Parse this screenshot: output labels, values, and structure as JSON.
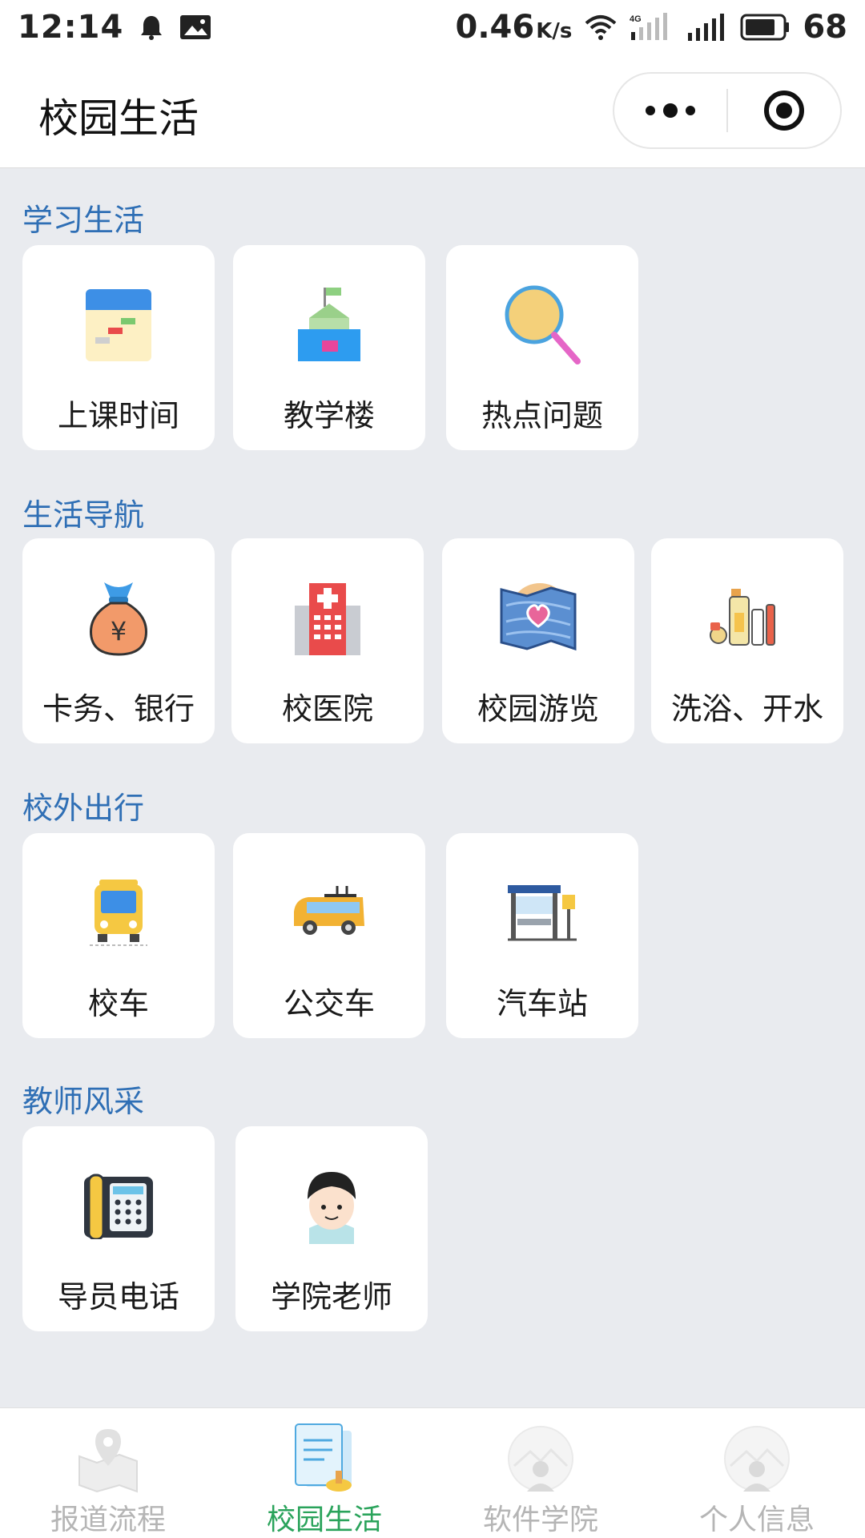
{
  "status_bar": {
    "time": "12:14",
    "speed": "0.46",
    "speed_unit": "K/s",
    "network_label": "4G",
    "battery": "68"
  },
  "nav": {
    "title": "校园生活"
  },
  "sections": [
    {
      "title": "学习生活",
      "items": [
        {
          "label": "上课时间",
          "icon": "calendar-icon"
        },
        {
          "label": "教学楼",
          "icon": "building-icon"
        },
        {
          "label": "热点问题",
          "icon": "magnifier-icon"
        }
      ]
    },
    {
      "title": "生活导航",
      "items": [
        {
          "label": "卡务、银行",
          "icon": "money-bag-icon"
        },
        {
          "label": "校医院",
          "icon": "hospital-icon"
        },
        {
          "label": "校园游览",
          "icon": "map-icon"
        },
        {
          "label": "洗浴、开水",
          "icon": "toiletries-icon"
        }
      ]
    },
    {
      "title": "校外出行",
      "items": [
        {
          "label": "校车",
          "icon": "school-bus-icon"
        },
        {
          "label": "公交车",
          "icon": "bus-icon"
        },
        {
          "label": "汽车站",
          "icon": "bus-station-icon"
        }
      ]
    },
    {
      "title": "教师风采",
      "items": [
        {
          "label": "导员电话",
          "icon": "telephone-icon"
        },
        {
          "label": "学院老师",
          "icon": "teacher-icon"
        }
      ]
    }
  ],
  "tabs": [
    {
      "label": "报道流程",
      "icon": "map-pin-icon",
      "active": false
    },
    {
      "label": "校园生活",
      "icon": "document-icon",
      "active": true
    },
    {
      "label": "软件学院",
      "icon": "avatar-icon",
      "active": false
    },
    {
      "label": "个人信息",
      "icon": "avatar-icon",
      "active": false
    }
  ],
  "colors": {
    "section_title": "#2f6fb5",
    "active_tab": "#2aa35b",
    "inactive_tab": "#b5b5b5",
    "background": "#e9ebef"
  }
}
